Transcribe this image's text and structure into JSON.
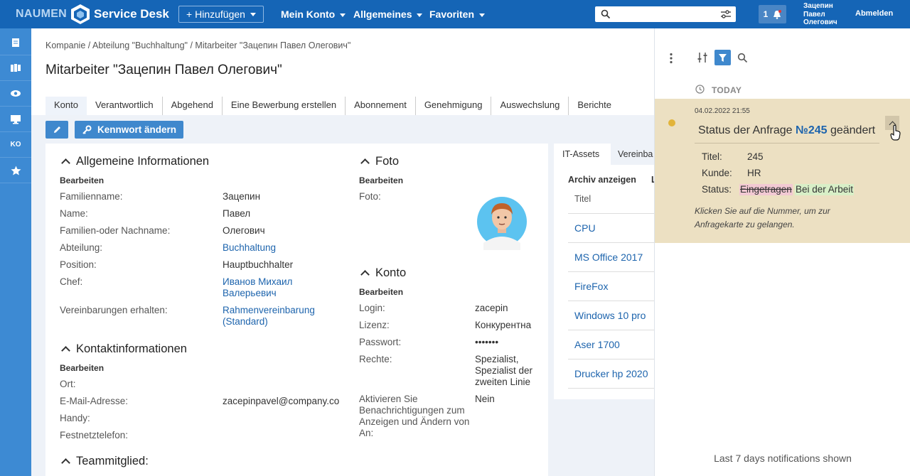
{
  "brand": {
    "left": "NAUMEN",
    "right": "Service Desk"
  },
  "header": {
    "add_label": "+ Hinzufügen",
    "menus": [
      "Mein Konto",
      "Allgemeines",
      "Favoriten"
    ],
    "notif_count": "1",
    "user_lines": [
      "Зацепин",
      "Павел",
      "Олегович"
    ],
    "logout": "Abmelden"
  },
  "sidebar": {
    "icons": [
      "document-icon",
      "board-icon",
      "eye-icon",
      "monitor-icon",
      "ko-icon",
      "star-icon"
    ],
    "ko_label": "KO"
  },
  "breadcrumb": "Kompanie / Abteilung \"Buchhaltung\" / Mitarbeiter \"Зацепин Павел Олегович\"",
  "page_title": "Mitarbeiter \"Зацепин Павел Олегович\"",
  "tabs": [
    "Konto",
    "Verantwortlich",
    "Abgehend",
    "Eine Bewerbung erstellen",
    "Abonnement",
    "Genehmigung",
    "Auswechslung",
    "Berichte"
  ],
  "actions": {
    "password": "Kennwort ändern"
  },
  "general": {
    "title": "Allgemeine Informationen",
    "edit": "Bearbeiten",
    "rows": [
      {
        "label": "Familienname:",
        "value": "Зацепин"
      },
      {
        "label": "Name:",
        "value": "Павел"
      },
      {
        "label": "Familien-oder Nachname:",
        "value": "Олегович"
      },
      {
        "label": "Abteilung:",
        "value": "Buchhaltung"
      },
      {
        "label": "Position:",
        "value": "Hauptbuchhalter"
      },
      {
        "label": "Chef:",
        "value": "Иванов Михаил",
        "value2": "Валерьевич"
      },
      {
        "label": "Vereinbarungen erhalten:",
        "value": "Rahmenvereinbarung",
        "value2": "(Standard)"
      }
    ]
  },
  "contact": {
    "title": "Kontaktinformationen",
    "edit": "Bearbeiten",
    "rows": [
      {
        "label": "Ort:",
        "value": ""
      },
      {
        "label": "E-Mail-Adresse:",
        "value": "zacepinpavel@company.co"
      },
      {
        "label": "Handy:",
        "value": ""
      },
      {
        "label": "Festnetztelefon:",
        "value": ""
      }
    ]
  },
  "team": {
    "title": "Teammitglied:"
  },
  "photo": {
    "title": "Foto",
    "edit": "Bearbeiten",
    "label": "Foto:"
  },
  "account": {
    "title": "Konto",
    "edit": "Bearbeiten",
    "rows": [
      {
        "label": "Login:",
        "value": "zacepin"
      },
      {
        "label": "Lizenz:",
        "value": "Конкурентна"
      },
      {
        "label": "Passwort:",
        "value": "•••••••"
      },
      {
        "label": "Rechte:",
        "value": "Spezialist,",
        "value2": "Spezialist der",
        "value3": "zweiten Linie"
      },
      {
        "label": "Aktivieren Sie",
        "label2": "Benachrichtigungen zum",
        "label3": "Anzeigen und Ändern von",
        "label4": "An:",
        "value": "Nein"
      }
    ]
  },
  "it": {
    "tabs": [
      "IT-Assets",
      "Vereinba"
    ],
    "archive": "Archiv anzeigen",
    "col": "Titel",
    "col2": "L",
    "items": [
      "CPU",
      "MS Office 2017",
      "FireFox",
      "Windows 10 pro",
      "Aser 1700",
      "Drucker hp 2020"
    ]
  },
  "notifications": {
    "group": "TODAY",
    "item": {
      "time": "04.02.2022 21:55",
      "title_prefix": "Status der Anfrage ",
      "number": "№245",
      "title_suffix": " geändert",
      "fields": [
        {
          "label": "Titel:",
          "value": "245"
        },
        {
          "label": "Kunde:",
          "value": "HR"
        }
      ],
      "status_label": "Status:",
      "status_old": "Eingetragen",
      "status_new": "Bei der Arbeit",
      "hint": "Klicken Sie auf die Nummer, um zur Anfragekarte zu gelangen."
    },
    "footer": "Last 7 days notifications shown"
  },
  "colors": {
    "header": "#1565b6",
    "sidebar": "#3d8ad3",
    "button": "#3f88cd",
    "notif_bg": "#ece0c2",
    "link": "#1d64ad"
  }
}
